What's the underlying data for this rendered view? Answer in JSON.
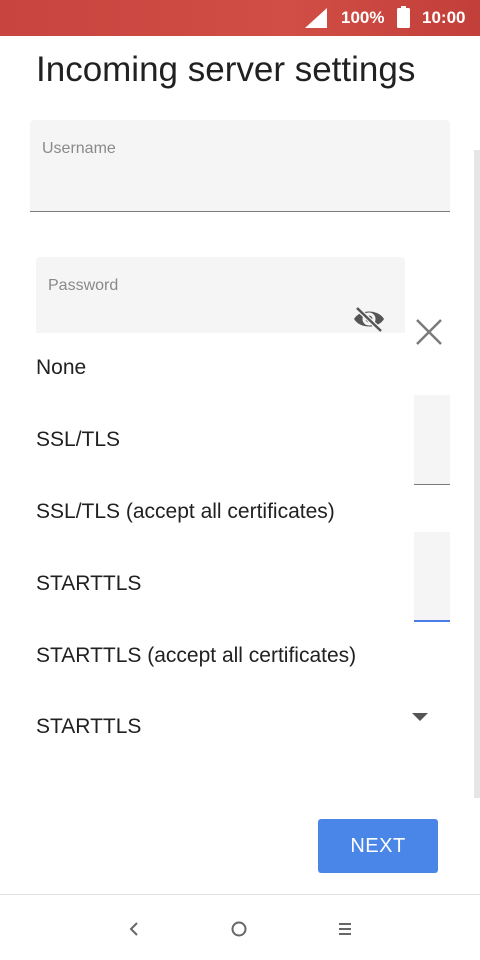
{
  "status_bar": {
    "battery": "100%",
    "time": "10:00"
  },
  "page": {
    "title": "Incoming server settings"
  },
  "form": {
    "username": {
      "label": "Username",
      "value": ""
    },
    "password": {
      "label": "Password",
      "value": ""
    }
  },
  "security_menu": {
    "items": [
      "None",
      "SSL/TLS",
      "SSL/TLS (accept all certificates)",
      "STARTTLS",
      "STARTTLS (accept all certificates)",
      "STARTTLS"
    ]
  },
  "actions": {
    "next_label": "NEXT"
  },
  "icons": {
    "signal": "signal-icon",
    "battery": "battery-icon",
    "password_toggle": "eye-off-icon",
    "close": "close-icon",
    "dropdown": "dropdown-arrow-icon",
    "back": "back-icon",
    "home": "home-icon",
    "recents": "recents-icon"
  }
}
